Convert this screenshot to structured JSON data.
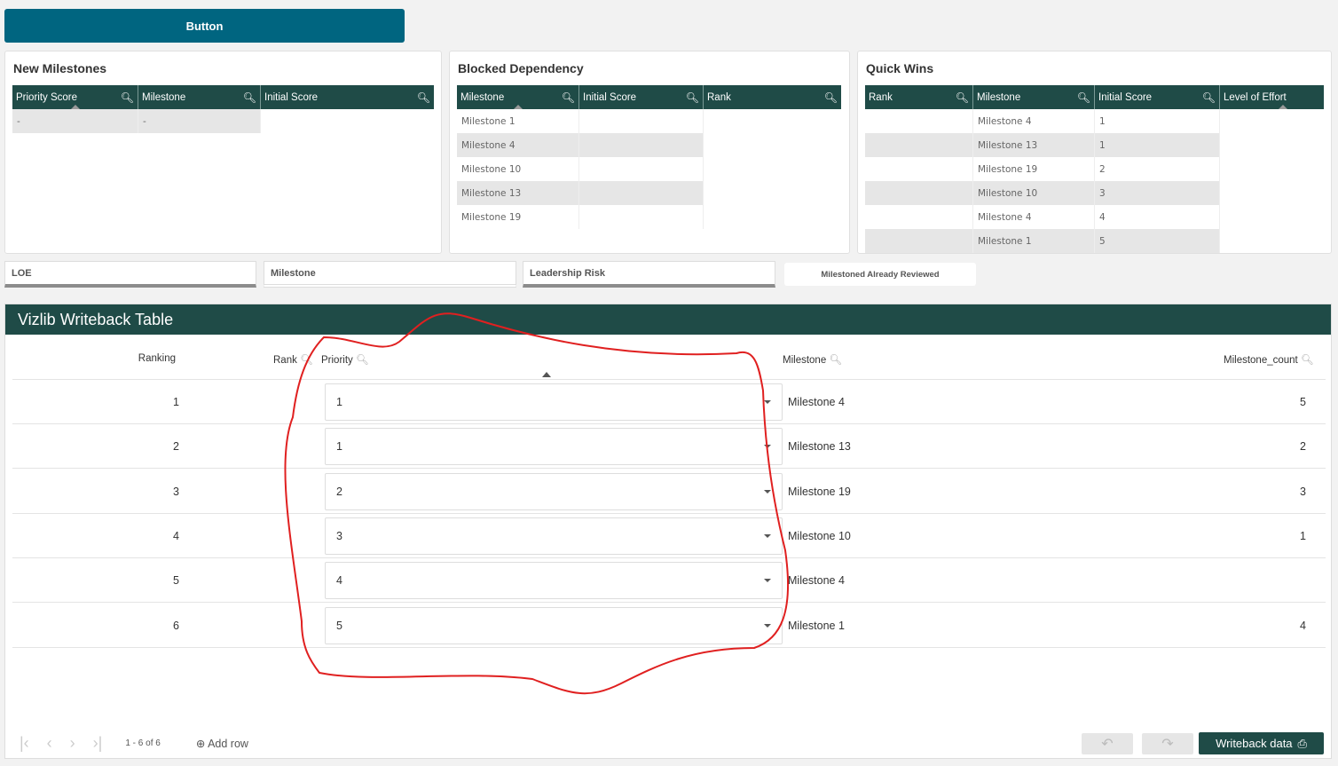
{
  "top_button": {
    "label": "Button"
  },
  "new_milestones": {
    "title": "New Milestones",
    "columns": [
      "Priority Score",
      "Milestone",
      "Initial Score"
    ],
    "rows": [
      [
        "-",
        "-",
        ""
      ]
    ]
  },
  "blocked_dependency": {
    "title": "Blocked Dependency",
    "columns": [
      "Milestone",
      "Initial Score",
      "Rank"
    ],
    "rows": [
      "Milestone 1",
      "Milestone 4",
      "Milestone 10",
      "Milestone 13",
      "Milestone 19"
    ]
  },
  "quick_wins": {
    "title": "Quick Wins",
    "columns": [
      "Rank",
      "Milestone",
      "Initial Score",
      "Level of Effort"
    ],
    "rows": [
      [
        "",
        "Milestone 4",
        "1"
      ],
      [
        "",
        "Milestone 13",
        "1"
      ],
      [
        "",
        "Milestone 19",
        "2"
      ],
      [
        "",
        "Milestone 10",
        "3"
      ],
      [
        "",
        "Milestone 4",
        "4"
      ],
      [
        "",
        "Milestone 1",
        "5"
      ]
    ]
  },
  "filters": [
    "LOE",
    "Milestone",
    "Leadership Risk"
  ],
  "reviewed_button": "Milestoned Already Reviewed",
  "writeback": {
    "title": "Vizlib Writeback Table",
    "columns": [
      "Ranking",
      "Rank",
      "Priority",
      "Milestone",
      "Milestone_count"
    ],
    "rows": [
      {
        "ranking": "1",
        "priority": "1",
        "milestone": "Milestone 4",
        "count": "5"
      },
      {
        "ranking": "2",
        "priority": "1",
        "milestone": "Milestone 13",
        "count": "2"
      },
      {
        "ranking": "3",
        "priority": "2",
        "milestone": "Milestone 19",
        "count": "3"
      },
      {
        "ranking": "4",
        "priority": "3",
        "milestone": "Milestone 10",
        "count": "1"
      },
      {
        "ranking": "5",
        "priority": "4",
        "milestone": "Milestone 4",
        "count": ""
      },
      {
        "ranking": "6",
        "priority": "5",
        "milestone": "Milestone 1",
        "count": "4"
      }
    ],
    "pagination": "1 - 6 of 6",
    "add_row": "Add row",
    "writeback_button": "Writeback data"
  },
  "annotation_color": "#e02020"
}
